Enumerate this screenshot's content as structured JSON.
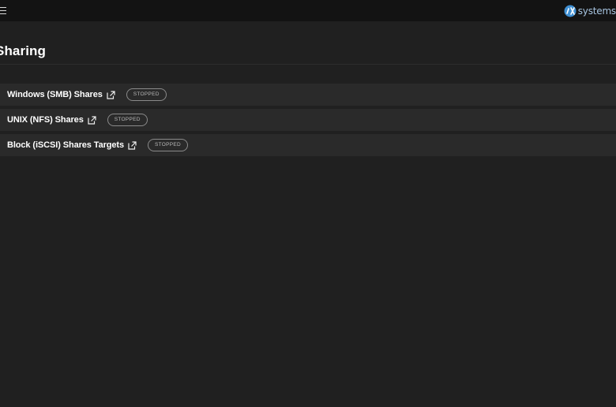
{
  "topbar": {
    "menu_icon": "hamburger-menu-icon",
    "brand_text": "systems",
    "brand_mark": "ix-logo"
  },
  "page": {
    "title": "Sharing"
  },
  "shares": [
    {
      "label": "Windows (SMB) Shares",
      "status": "STOPPED",
      "icon": "open-in-new-icon"
    },
    {
      "label": "UNIX (NFS) Shares",
      "status": "STOPPED",
      "icon": "open-in-new-icon"
    },
    {
      "label": "Block (iSCSI) Shares Targets",
      "status": "STOPPED",
      "icon": "open-in-new-icon"
    }
  ],
  "colors": {
    "background": "#202020",
    "topbar": "#131313",
    "row": "#2a2a2a",
    "brand": "#a7c4e0",
    "brand_mark": "#3f8fd2"
  }
}
